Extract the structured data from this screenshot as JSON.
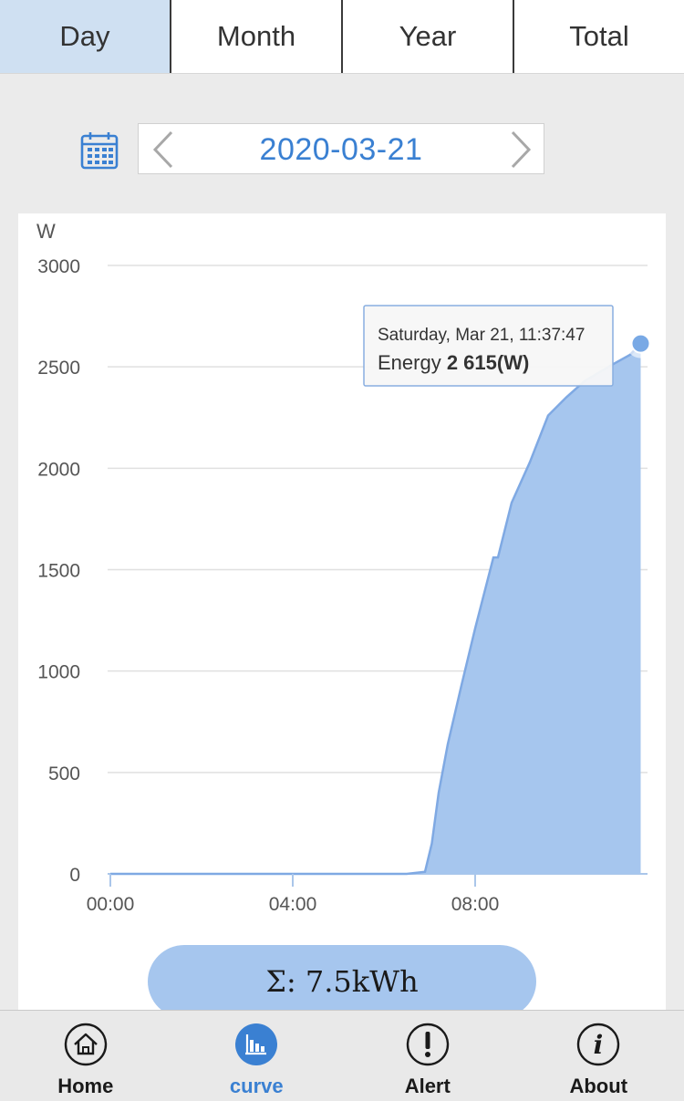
{
  "tabs": [
    {
      "label": "Day",
      "active": true
    },
    {
      "label": "Month",
      "active": false
    },
    {
      "label": "Year",
      "active": false
    },
    {
      "label": "Total",
      "active": false
    }
  ],
  "date_picker": {
    "value": "2020-03-21"
  },
  "chart_data": {
    "type": "area",
    "ylabel": "W",
    "ylim": [
      0,
      3000
    ],
    "yticks": [
      0,
      500,
      1000,
      1500,
      2000,
      2500,
      3000
    ],
    "xticks": [
      "00:00",
      "04:00",
      "08:00"
    ],
    "x_unit": "hours",
    "x": [
      0,
      6.5,
      6.9,
      7.05,
      7.2,
      7.4,
      7.7,
      8.0,
      8.4,
      8.5,
      8.8,
      9.2,
      9.6,
      10.0,
      10.4,
      10.7,
      11.0,
      11.4,
      11.63
    ],
    "y": [
      0,
      0,
      10,
      150,
      400,
      640,
      930,
      1210,
      1560,
      1560,
      1830,
      2030,
      2260,
      2350,
      2430,
      2470,
      2510,
      2560,
      2615
    ],
    "series": [
      {
        "color": "#a6c6ee"
      }
    ],
    "grid": true,
    "tooltip": {
      "time": "Saturday, Mar 21, 11:37:47",
      "label": "Energy",
      "value": "2 615(W)"
    }
  },
  "summary": {
    "text": "Σ:  7.5kWh"
  },
  "nav": [
    {
      "label": "Home",
      "icon": "home-icon",
      "active": false
    },
    {
      "label": "curve",
      "icon": "chart-icon",
      "active": true
    },
    {
      "label": "Alert",
      "icon": "alert-icon",
      "active": false
    },
    {
      "label": "About",
      "icon": "info-icon",
      "active": false
    }
  ],
  "colors": {
    "accent": "#3a80d2",
    "area_fill": "#a6c6ee",
    "area_line": "#7fa9e3",
    "tab_active_bg": "#cfe0f2"
  }
}
